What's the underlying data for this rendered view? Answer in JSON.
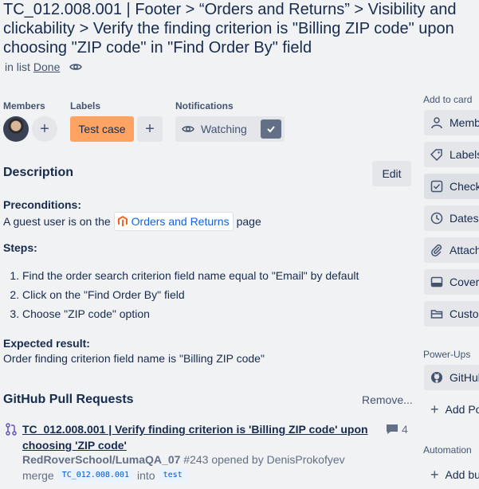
{
  "card": {
    "title_lines": [
      "TC_012.008.001 | Footer > “Orders and Returns” > Visibility and",
      "clickability > Verify the finding criterion is \"Billing ZIP code\" upon",
      "choosing \"ZIP code\" in \"Find Order By\" field"
    ],
    "in_list_prefix": "in list",
    "list_name": "Done"
  },
  "members": {
    "label": "Members"
  },
  "labels": {
    "label": "Labels",
    "chip": "Test case",
    "chip_color": "#fea362"
  },
  "notifications": {
    "label": "Notifications",
    "watch_label": "Watching"
  },
  "description": {
    "heading": "Description",
    "edit_label": "Edit",
    "preconditions_heading": "Preconditions:",
    "precondition_before": "A guest user is on the",
    "precondition_link": "Orders and Returns",
    "precondition_after": "page",
    "steps_heading": "Steps:",
    "steps": [
      "Find the order search criterion field name equal to \"Email\" by default",
      "Click on the \"Find Order By\" field",
      "Choose \"ZIP code\" option"
    ],
    "expected_heading": "Expected result:",
    "expected_text": "Order finding criterion field name is \"Billing ZIP code\""
  },
  "github": {
    "heading": "GitHub Pull Requests",
    "remove_label": "Remove...",
    "pr": {
      "title_line1": "TC_012.008.001 | Verify finding criterion is 'Billing ZIP code' upon",
      "title_line2": "choosing 'ZIP code'",
      "repo": "RedRoverSchool/LumaQA_07",
      "meta": "#243 opened by DenisProkofyev",
      "merge_word": "merge",
      "source_branch": "TC_012.008.001",
      "into_word": "into",
      "target_branch": "test",
      "comments": "4"
    }
  },
  "sidebar": {
    "add_to_card": "Add to card",
    "buttons": [
      {
        "label": "Members",
        "icon": "person-icon"
      },
      {
        "label": "Labels",
        "icon": "tag-icon"
      },
      {
        "label": "Checklist",
        "icon": "checklist-icon"
      },
      {
        "label": "Dates",
        "icon": "clock-icon"
      },
      {
        "label": "Attachment",
        "icon": "paperclip-icon"
      },
      {
        "label": "Cover",
        "icon": "cover-icon"
      },
      {
        "label": "Custom Fields",
        "icon": "custom-fields-icon"
      }
    ],
    "powerups_heading": "Power-Ups",
    "github_button": "GitHub",
    "add_powerup": "Add Power-Up",
    "automation_heading": "Automation",
    "add_button": "Add button"
  }
}
